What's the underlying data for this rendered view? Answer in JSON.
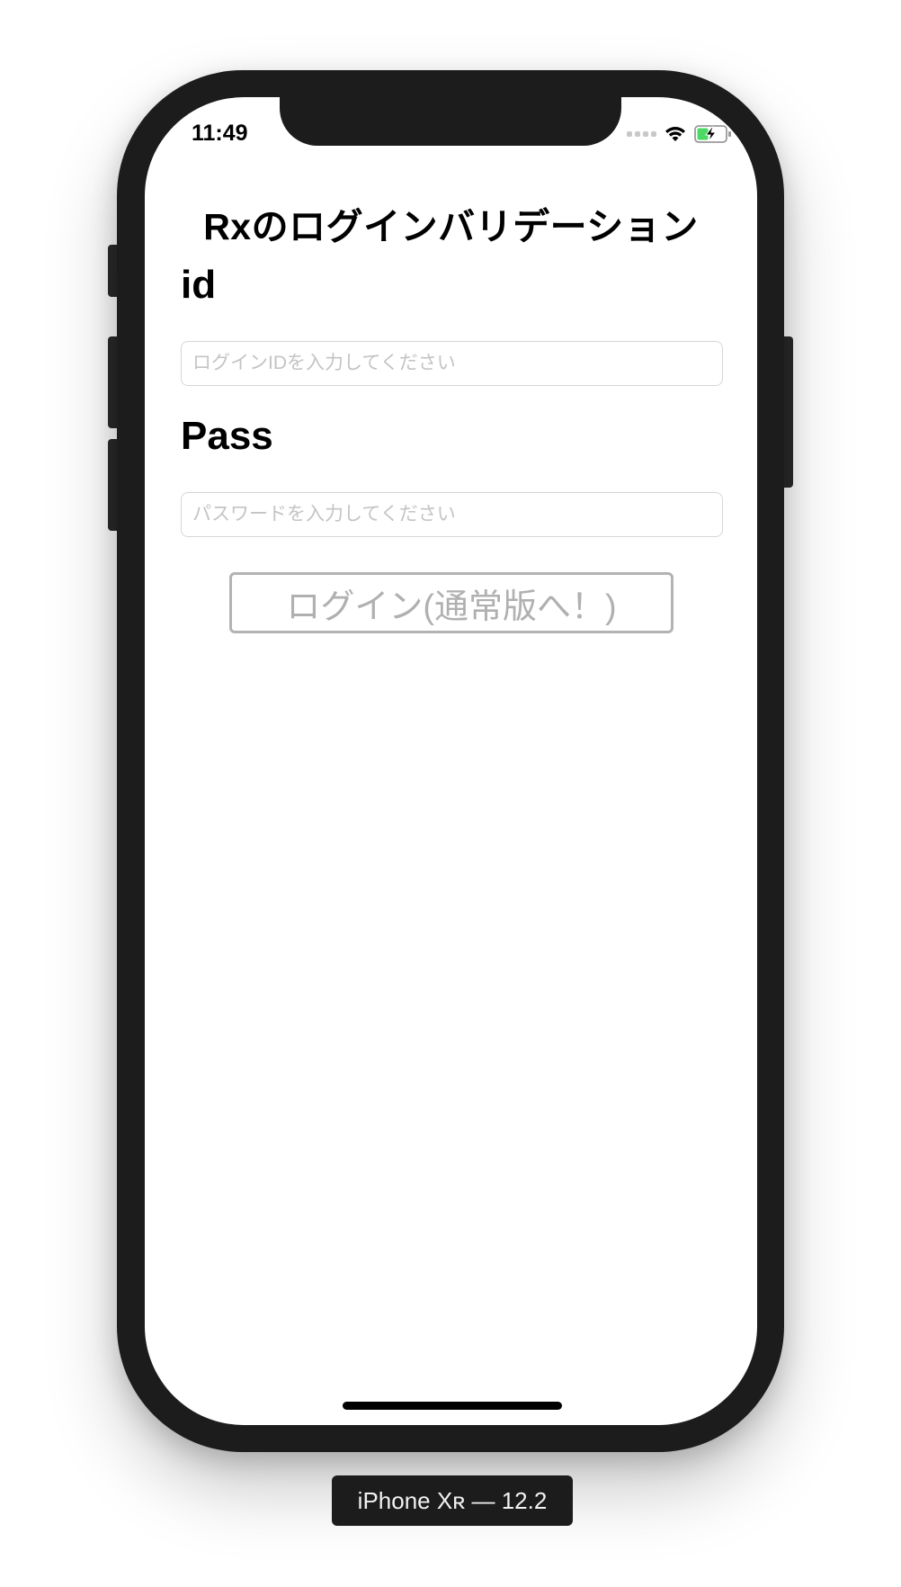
{
  "status_bar": {
    "time": "11:49"
  },
  "app": {
    "title": "Rxのログインバリデーション",
    "id_label": "id",
    "id_placeholder": "ログインIDを入力してください",
    "pass_label": "Pass",
    "pass_placeholder": "パスワードを入力してください",
    "login_button_label": "ログイン(通常版へ！)"
  },
  "simulator": {
    "device_label": "iPhone Xʀ — 12.2"
  },
  "colors": {
    "frame": "#1c1c1c",
    "battery_green": "#4cd964",
    "placeholder": "#c4c4c4",
    "disabled_button": "#b0b0b0"
  },
  "icons": [
    "cellular-signal-icon",
    "wifi-icon",
    "battery-charging-icon"
  ]
}
